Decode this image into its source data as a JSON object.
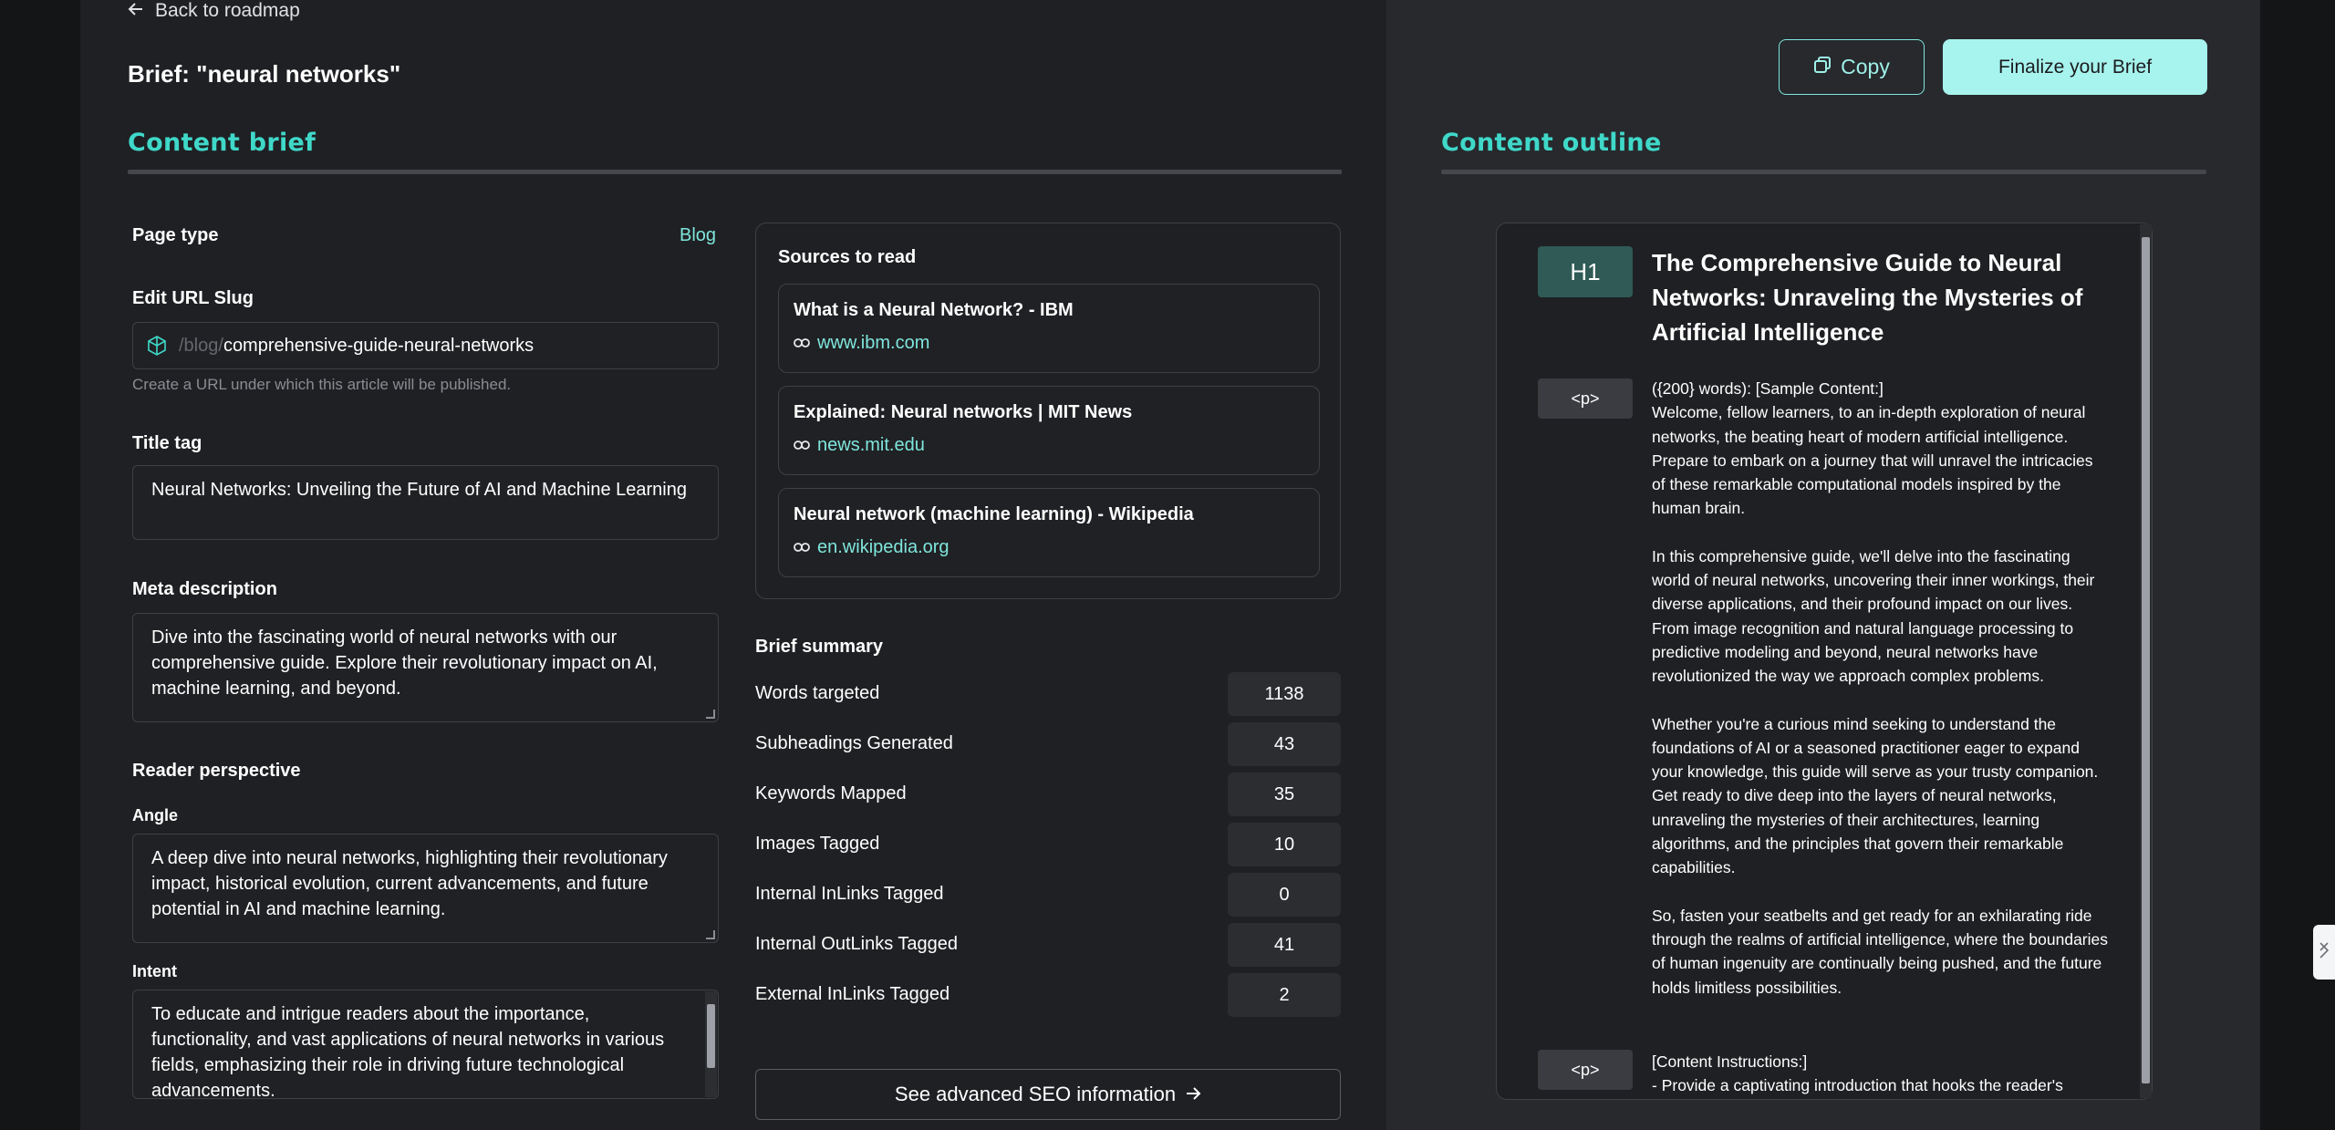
{
  "nav": {
    "back_label": "Back to roadmap"
  },
  "page_title": "Brief: \"neural networks\"",
  "toolbar": {
    "copy_label": "Copy",
    "finalize_label": "Finalize your Brief"
  },
  "content_brief": {
    "heading": "Content brief",
    "page_type": {
      "label": "Page type",
      "value": "Blog"
    },
    "url_slug": {
      "label": "Edit URL Slug",
      "prefix": "/blog/",
      "value": "comprehensive-guide-neural-networks",
      "help": "Create a URL under which this article will be published."
    },
    "title_tag": {
      "label": "Title tag",
      "value": "Neural Networks: Unveiling the Future of AI and Machine Learning"
    },
    "meta_description": {
      "label": "Meta description",
      "value": "Dive into the fascinating world of neural networks with our comprehensive guide. Explore their revolutionary impact on AI, machine learning, and beyond."
    },
    "reader_perspective": {
      "label": "Reader perspective",
      "angle_label": "Angle",
      "angle_value": "A deep dive into neural networks, highlighting their revolutionary impact, historical evolution, current advancements, and future potential in AI and machine learning.",
      "intent_label": "Intent",
      "intent_value": "To educate and intrigue readers about the importance, functionality, and vast applications of neural networks in various fields, emphasizing their role in driving future technological advancements."
    }
  },
  "sources": {
    "title": "Sources to read",
    "items": [
      {
        "title": "What is a Neural Network? - IBM",
        "url": "www.ibm.com"
      },
      {
        "title": "Explained: Neural networks | MIT News",
        "url": "news.mit.edu"
      },
      {
        "title": "Neural network (machine learning) - Wikipedia",
        "url": "en.wikipedia.org"
      }
    ]
  },
  "brief_summary": {
    "title": "Brief summary",
    "rows": [
      {
        "label": "Words targeted",
        "value": "1138"
      },
      {
        "label": "Subheadings Generated",
        "value": "43"
      },
      {
        "label": "Keywords Mapped",
        "value": "35"
      },
      {
        "label": "Images Tagged",
        "value": "10"
      },
      {
        "label": "Internal InLinks Tagged",
        "value": "0"
      },
      {
        "label": "Internal OutLinks Tagged",
        "value": "41"
      },
      {
        "label": "External InLinks Tagged",
        "value": "2"
      }
    ],
    "seo_button_label": "See advanced SEO information"
  },
  "content_outline": {
    "heading": "Content outline",
    "h1": {
      "tag": "H1",
      "text": "The Comprehensive Guide to Neural Networks: Unraveling the Mysteries of Artificial Intelligence"
    },
    "p1": {
      "tag": "<p>",
      "header": "({200} words): [Sample Content:]",
      "paragraphs": [
        "Welcome, fellow learners, to an in-depth exploration of neural networks, the beating heart of modern artificial intelligence. Prepare to embark on a journey that will unravel the intricacies of these remarkable computational models inspired by the human brain.",
        "In this comprehensive guide, we'll delve into the fascinating world of neural networks, uncovering their inner workings, their diverse applications, and their profound impact on our lives. From image recognition and natural language processing to predictive modeling and beyond, neural networks have revolutionized the way we approach complex problems.",
        "Whether you're a curious mind seeking to understand the foundations of AI or a seasoned practitioner eager to expand your knowledge, this guide will serve as your trusty companion. Get ready to dive deep into the layers of neural networks, unraveling the mysteries of their architectures, learning algorithms, and the principles that govern their remarkable capabilities.",
        "So, fasten your seatbelts and get ready for an exhilarating ride through the realms of artificial intelligence, where the boundaries of human ingenuity are continually being pushed, and the future holds limitless possibilities."
      ]
    },
    "p2": {
      "tag": "<p>",
      "header": "[Content Instructions:]",
      "line": "- Provide a captivating introduction that hooks the reader's"
    }
  },
  "colors": {
    "accent": "#3fd8c9",
    "link": "#7fe6dd",
    "button": "#a7f3ee"
  },
  "icons": [
    "arrow-left-icon",
    "cube-icon",
    "link-icon",
    "copy-icon",
    "arrow-right-icon",
    "collapse-icon"
  ]
}
